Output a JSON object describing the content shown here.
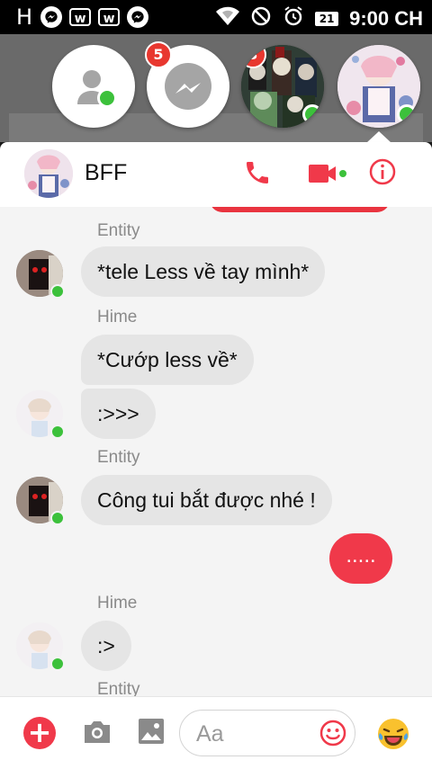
{
  "status_bar": {
    "carrier_glyph": "H",
    "battery_level": "21",
    "time": "9:00 CH"
  },
  "chat_heads": [
    {
      "name": "contacts",
      "badge": "",
      "online": true
    },
    {
      "name": "messenger",
      "badge": "5",
      "online": false
    },
    {
      "name": "group-anime",
      "badge": "3",
      "online": true
    },
    {
      "name": "bff",
      "badge": "",
      "online": true
    }
  ],
  "header": {
    "title": "BFF",
    "accent_color": "#f0394a"
  },
  "messages": [
    {
      "sender": "Entity",
      "text": "*tele Less về tay mình*"
    },
    {
      "sender": "Hime",
      "text": "*Cướp less về*"
    },
    {
      "sender": "Hime",
      "text": ":>>>"
    },
    {
      "sender": "Entity",
      "text": "Công tui bắt được nhé !"
    },
    {
      "sender": "me",
      "text": "....."
    },
    {
      "sender": "Hime",
      "text": ":>"
    },
    {
      "sender": "Entity",
      "text": ""
    }
  ],
  "composer": {
    "placeholder": "Aa"
  }
}
